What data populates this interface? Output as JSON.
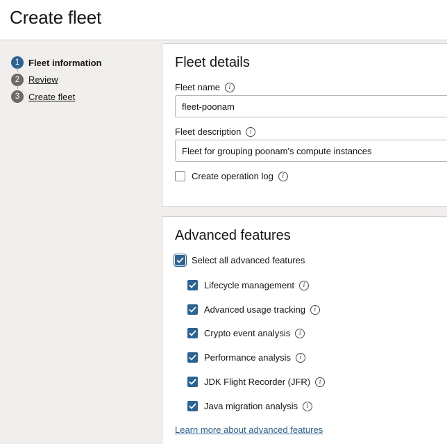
{
  "header": {
    "title": "Create fleet"
  },
  "steps": [
    {
      "number": "1",
      "label": "Fleet information"
    },
    {
      "number": "2",
      "label": "Review"
    },
    {
      "number": "3",
      "label": "Create fleet"
    }
  ],
  "fleet_details": {
    "title": "Fleet details",
    "name_label": "Fleet name",
    "name_value": "fleet-poonam",
    "description_label": "Fleet description",
    "description_value": "Fleet for grouping poonam's compute instances",
    "operation_log_label": "Create operation log",
    "operation_log_checked": false
  },
  "advanced": {
    "title": "Advanced features",
    "select_all_label": "Select all advanced features",
    "features": [
      {
        "label": "Lifecycle management",
        "checked": true
      },
      {
        "label": "Advanced usage tracking",
        "checked": true
      },
      {
        "label": "Crypto event analysis",
        "checked": true
      },
      {
        "label": "Performance analysis",
        "checked": true
      },
      {
        "label": "JDK Flight Recorder (JFR)",
        "checked": true
      },
      {
        "label": "Java migration analysis",
        "checked": true
      }
    ],
    "learn_more": "Learn more about advanced features"
  },
  "icons": {
    "info": "info-icon",
    "check": "checkmark-icon"
  },
  "colors": {
    "accent": "#2b6394",
    "step_inactive": "#6f6964",
    "background": "#f1efed"
  }
}
